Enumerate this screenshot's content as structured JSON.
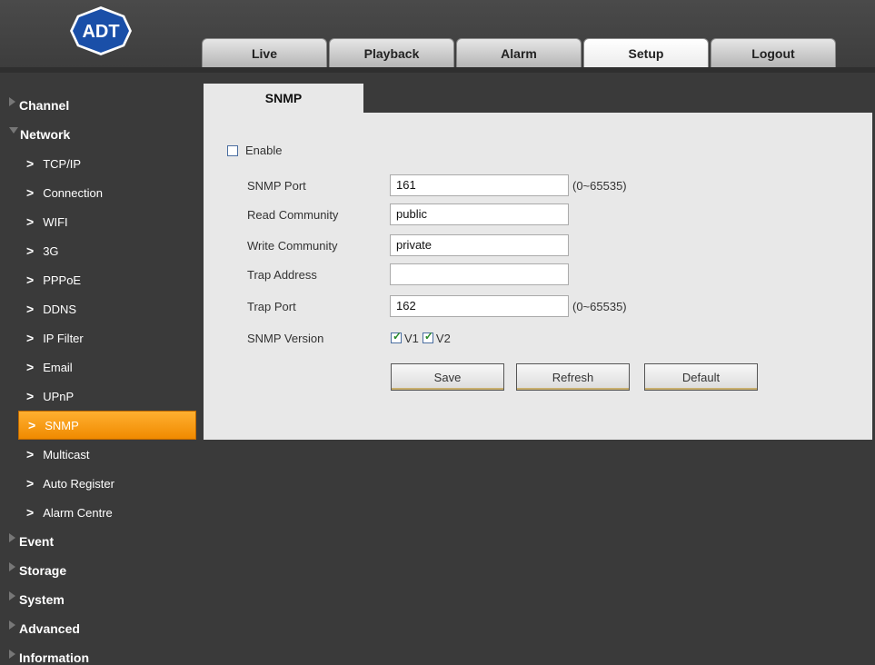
{
  "logo": {
    "text": "ADT",
    "color": "#1a4fa8"
  },
  "tabs": [
    {
      "label": "Live"
    },
    {
      "label": "Playback"
    },
    {
      "label": "Alarm"
    },
    {
      "label": "Setup",
      "active": true
    },
    {
      "label": "Logout"
    }
  ],
  "sidebar": {
    "channel": "Channel",
    "network": "Network",
    "network_items": [
      "TCP/IP",
      "Connection",
      "WIFI",
      "3G",
      "PPPoE",
      "DDNS",
      "IP Filter",
      "Email",
      "UPnP",
      "SNMP",
      "Multicast",
      "Auto Register",
      "Alarm Centre"
    ],
    "active_item": "SNMP",
    "event": "Event",
    "storage": "Storage",
    "system": "System",
    "advanced": "Advanced",
    "information": "Information",
    "chevron": ">"
  },
  "content": {
    "tab_title": "SNMP",
    "enable_label": "Enable",
    "enable_checked": false,
    "snmp_port_label": "SNMP Port",
    "snmp_port_value": "161",
    "snmp_port_hint": "(0~65535)",
    "read_community_label": "Read Community",
    "read_community_value": "public",
    "write_community_label": "Write Community",
    "write_community_value": "private",
    "trap_address_label": "Trap Address",
    "trap_address_value": "",
    "trap_port_label": "Trap Port",
    "trap_port_value": "162",
    "trap_port_hint": "(0~65535)",
    "snmp_version_label": "SNMP Version",
    "v1_label": "V1",
    "v1_checked": true,
    "v2_label": "V2",
    "v2_checked": true,
    "save_label": "Save",
    "refresh_label": "Refresh",
    "default_label": "Default"
  },
  "colors": {
    "accent": "#f59a0c",
    "background": "#3a3a3a",
    "panel": "#e8e8e8"
  }
}
